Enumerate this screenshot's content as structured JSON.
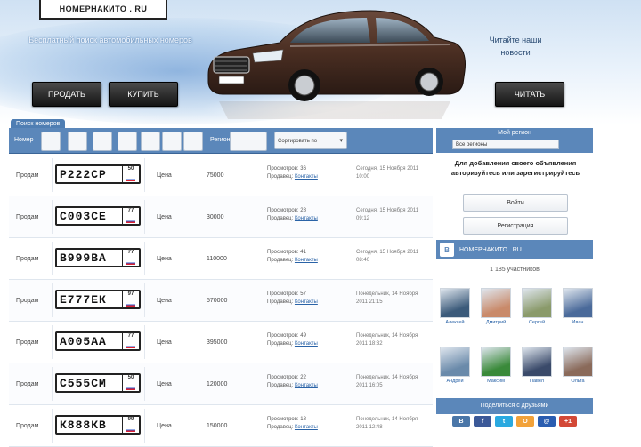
{
  "header": {
    "logo_text": "НОМЕРНАКИТО . RU",
    "tagline": "Бесплатный поиск автомобильных номеров",
    "news_text": "Читайте наши новости",
    "sell_label": "ПРОДАТЬ",
    "buy_label": "КУПИТЬ",
    "read_label": "ЧИТАТЬ"
  },
  "filters": {
    "tab_label": "Поиск номеров",
    "number_label": "Номер",
    "region_label": "Регион",
    "sort_label": "Сортировать по",
    "digits": [
      "",
      "",
      "",
      "",
      "",
      "",
      ""
    ]
  },
  "right_panel": {
    "title": "Мой регион",
    "select_value": "Все регионы"
  },
  "listings": [
    {
      "type": "Продам",
      "plate": "Р222СР",
      "region": "50",
      "price_label": "Цена",
      "price": "75000",
      "seller_line": "Просмотров: 36",
      "seller_prefix": "Продавец:",
      "seller_name": "Контакты",
      "date": "Сегодня, 15 Ноября 2011 10:00"
    },
    {
      "type": "Продам",
      "plate": "С003СЕ",
      "region": "77",
      "price_label": "Цена",
      "price": "30000",
      "seller_line": "Просмотров: 28",
      "seller_prefix": "Продавец:",
      "seller_name": "Контакты",
      "date": "Сегодня, 15 Ноября 2011 09:12"
    },
    {
      "type": "Продам",
      "plate": "В999ВА",
      "region": "77",
      "price_label": "Цена",
      "price": "110000",
      "seller_line": "Просмотров: 41",
      "seller_prefix": "Продавец:",
      "seller_name": "Контакты",
      "date": "Сегодня, 15 Ноября 2011 08:40"
    },
    {
      "type": "Продам",
      "plate": "Е777ЕК",
      "region": "97",
      "price_label": "Цена",
      "price": "570000",
      "seller_line": "Просмотров: 57",
      "seller_prefix": "Продавец:",
      "seller_name": "Контакты",
      "date": "Понедельник, 14 Ноября 2011 21:15"
    },
    {
      "type": "Продам",
      "plate": "А005АА",
      "region": "77",
      "price_label": "Цена",
      "price": "395000",
      "seller_line": "Просмотров: 49",
      "seller_prefix": "Продавец:",
      "seller_name": "Контакты",
      "date": "Понедельник, 14 Ноября 2011 18:32"
    },
    {
      "type": "Продам",
      "plate": "С555СМ",
      "region": "50",
      "price_label": "Цена",
      "price": "120000",
      "seller_line": "Просмотров: 22",
      "seller_prefix": "Продавец:",
      "seller_name": "Контакты",
      "date": "Понедельник, 14 Ноября 2011 16:05"
    },
    {
      "type": "Продам",
      "plate": "К888КВ",
      "region": "99",
      "price_label": "Цена",
      "price": "150000",
      "seller_line": "Просмотров: 18",
      "seller_prefix": "Продавец:",
      "seller_name": "Контакты",
      "date": "Понедельник, 14 Ноября 2011 12:48"
    }
  ],
  "sidebar": {
    "info_text": "Для добавления своего объявления авторизуйтесь или зарегистрируйтесь",
    "login_label": "Войти",
    "register_label": "Регистрация",
    "vk_label": "В",
    "vk_title": "НОМЕРНАКИТО . RU",
    "members_count": "1 185 участников",
    "members": [
      {
        "name": "Алексей",
        "color": "#3b5a7a"
      },
      {
        "name": "Дмитрий",
        "color": "#c98a6a"
      },
      {
        "name": "Сергей",
        "color": "#8a9a6a"
      },
      {
        "name": "Иван",
        "color": "#4a6a9a"
      },
      {
        "name": "Андрей",
        "color": "#6a8aaa"
      },
      {
        "name": "Максим",
        "color": "#3a8a3a"
      },
      {
        "name": "Павел",
        "color": "#3a4a6a"
      },
      {
        "name": "Ольга",
        "color": "#8a6a5a"
      }
    ],
    "share_title": "Поделиться с друзьями",
    "social": [
      {
        "label": "В",
        "color": "#4a76a8"
      },
      {
        "label": "f",
        "color": "#3b5998"
      },
      {
        "label": "t",
        "color": "#2aa9e0"
      },
      {
        "label": "О",
        "color": "#f2a23a"
      },
      {
        "label": "@",
        "color": "#2a5db0"
      },
      {
        "label": "+1",
        "color": "#d34836"
      }
    ]
  },
  "colors": {
    "accent": "#5b87ba",
    "header_button": "#1a1a1a",
    "car": "#4a2e22"
  }
}
